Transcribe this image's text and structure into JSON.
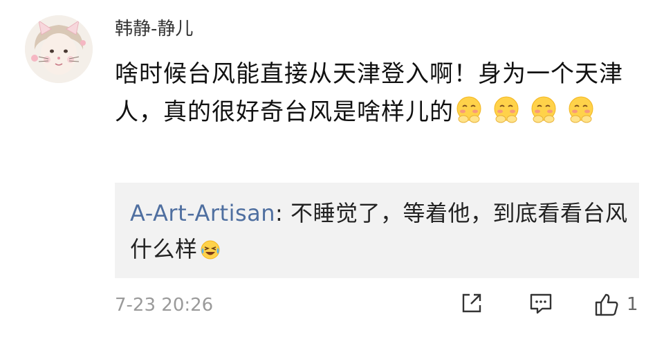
{
  "comment": {
    "username": "韩静-静儿",
    "text": "啥时候台风能直接从天津登入啊！身为一个天津人，真的很好奇台风是啥样儿的",
    "emojis": [
      "blush-emoji",
      "blush-emoji",
      "blush-emoji",
      "blush-emoji"
    ],
    "timestamp": "7-23 20:26",
    "like_count": "1"
  },
  "reply": {
    "username": "A-Art-Artisan",
    "separator": ": ",
    "text": "不睡觉了，等着他，到底看看台风什么样",
    "emoji": "laugh-cry-emoji"
  },
  "icons": {
    "share": "share-icon",
    "reply": "comment-icon",
    "like": "thumbs-up-icon"
  },
  "colors": {
    "reply_username": "#4f6fa0",
    "reply_background": "#f2f2f2",
    "timestamp": "#9a9a9a"
  }
}
